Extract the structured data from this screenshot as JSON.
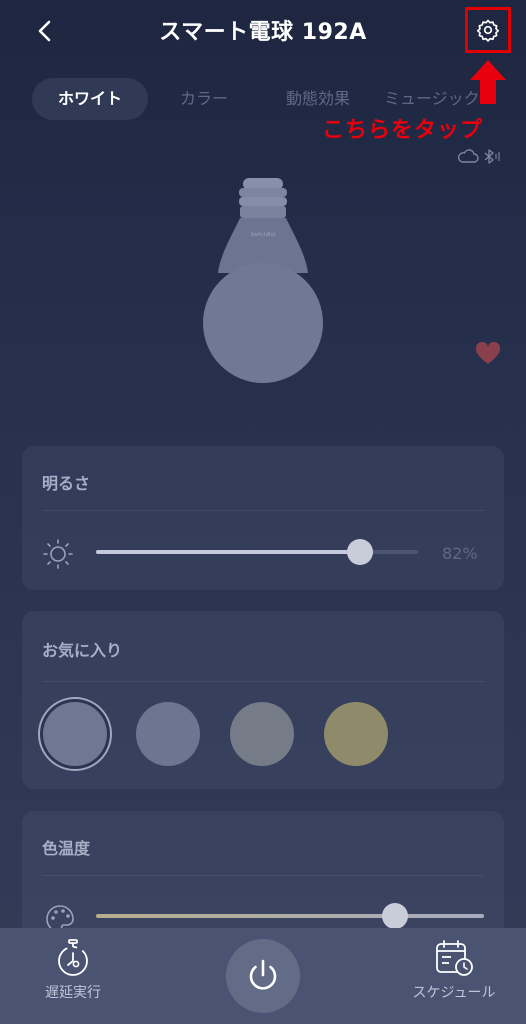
{
  "header": {
    "title": "スマート電球 192A",
    "back_icon": "chevron-left-icon",
    "settings_icon": "gear-icon"
  },
  "annotation": {
    "text": "こちらをタップ",
    "color": "#e8000d",
    "arrow_icon": "arrow-up-icon"
  },
  "tabs": [
    {
      "label": "ホワイト",
      "active": true
    },
    {
      "label": "カラー",
      "active": false
    },
    {
      "label": "動態効果",
      "active": false
    },
    {
      "label": "ミュージック",
      "active": false
    }
  ],
  "status_icons": [
    "cloud-icon",
    "bluetooth-icon"
  ],
  "bulb": {
    "icon": "lightbulb-icon",
    "brand_text": "SwitchBot"
  },
  "favorite_icon": "heart-icon",
  "brightness": {
    "title": "明るさ",
    "icon": "sun-icon",
    "value": 82,
    "value_text": "82%"
  },
  "favorites": {
    "title": "お気に入り",
    "swatches": [
      {
        "color": "#6e7892",
        "selected": true
      },
      {
        "color": "#6c7690",
        "selected": false
      },
      {
        "color": "#757c88",
        "selected": false
      },
      {
        "color": "#8f8a6a",
        "selected": false
      }
    ]
  },
  "color_temperature": {
    "title": "色温度",
    "icon": "palette-icon",
    "value": 0.77
  },
  "bottom_bar": {
    "timer_label": "遅延実行",
    "timer_icon": "stopwatch-icon",
    "power_icon": "power-icon",
    "schedule_label": "スケジュール",
    "schedule_icon": "calendar-clock-icon"
  },
  "colors": {
    "accent_red": "#e30000",
    "background": "#242c46"
  }
}
